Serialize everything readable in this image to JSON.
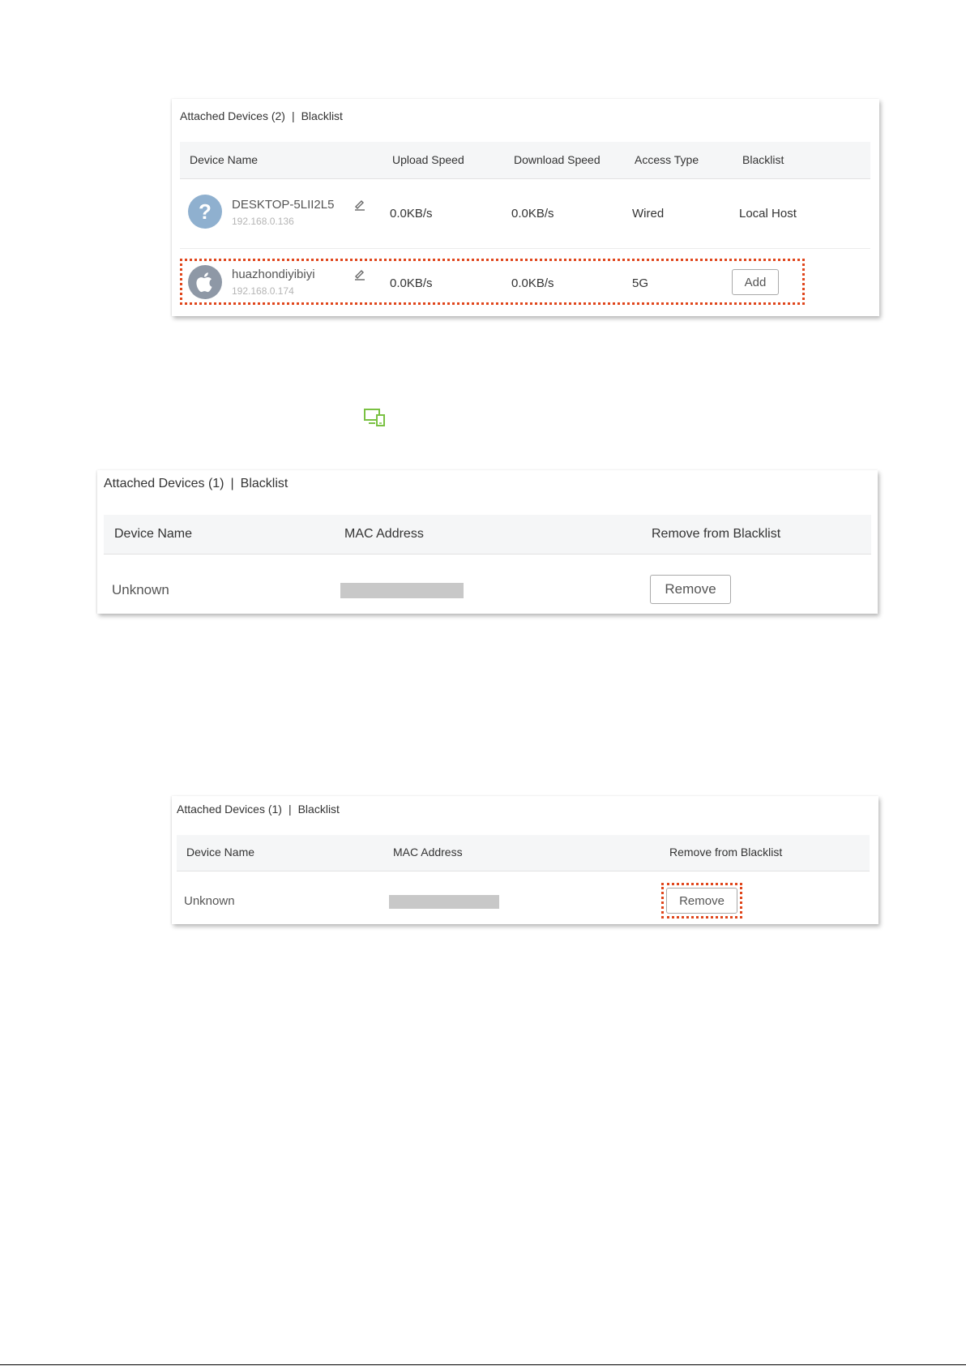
{
  "panel1": {
    "tab_attached": "Attached Devices (2)",
    "tab_separator": "|",
    "tab_blacklist": "Blacklist",
    "columns": [
      "Device Name",
      "Upload Speed",
      "Download Speed",
      "Access Type",
      "Blacklist"
    ],
    "rows": [
      {
        "icon": "question-icon",
        "name": "DESKTOP-5LII2L5",
        "ip": "192.168.0.136",
        "upload": "0.0KB/s",
        "download": "0.0KB/s",
        "access": "Wired",
        "blacklist": "Local Host"
      },
      {
        "icon": "apple-icon",
        "name": "huazhondiyibiyi",
        "ip": "192.168.0.174",
        "upload": "0.0KB/s",
        "download": "0.0KB/s",
        "access": "5G",
        "blacklist_button": "Add"
      }
    ]
  },
  "device_icon": "devices-icon",
  "panel2": {
    "tab_attached": "Attached Devices (1)",
    "tab_separator": "|",
    "tab_blacklist": "Blacklist",
    "columns": [
      "Device Name",
      "MAC Address",
      "Remove from Blacklist"
    ],
    "row": {
      "name": "Unknown",
      "remove_button": "Remove"
    }
  },
  "panel3": {
    "tab_attached": "Attached Devices (1)",
    "tab_separator": "|",
    "tab_blacklist": "Blacklist",
    "columns": [
      "Device Name",
      "MAC Address",
      "Remove from Blacklist"
    ],
    "row": {
      "name": "Unknown",
      "remove_button": "Remove"
    }
  },
  "colors": {
    "highlight": "#e0461c",
    "icon_green": "#7ac143",
    "avatar_question": "#8fb0cf",
    "avatar_apple": "#8e98a6"
  }
}
